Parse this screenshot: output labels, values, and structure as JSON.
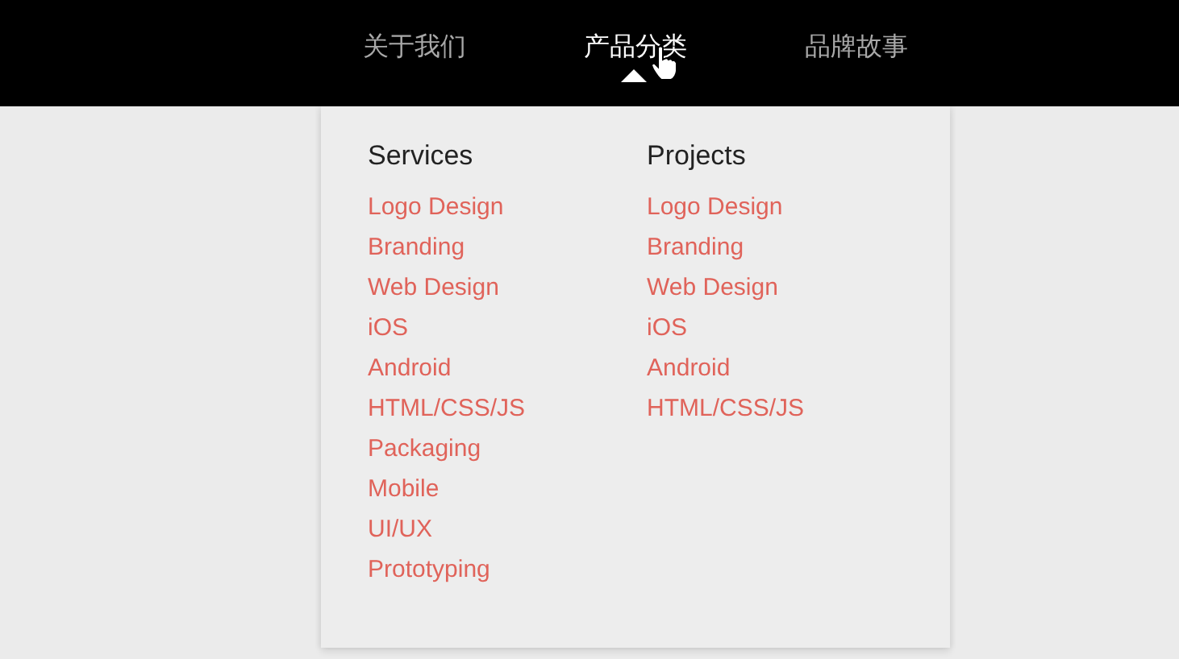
{
  "nav": [
    {
      "label": "关于我们",
      "selected": false
    },
    {
      "label": "产品分类",
      "selected": true
    },
    {
      "label": "品牌故事",
      "selected": false
    }
  ],
  "dropdown": {
    "columns": [
      {
        "title": "Services",
        "links": [
          "Logo Design",
          "Branding",
          "Web Design",
          "iOS",
          "Android",
          "HTML/CSS/JS",
          "Packaging",
          "Mobile",
          "UI/UX",
          "Prototyping"
        ]
      },
      {
        "title": "Projects",
        "links": [
          "Logo Design",
          "Branding",
          "Web Design",
          "iOS",
          "Android",
          "HTML/CSS/JS"
        ]
      }
    ]
  }
}
